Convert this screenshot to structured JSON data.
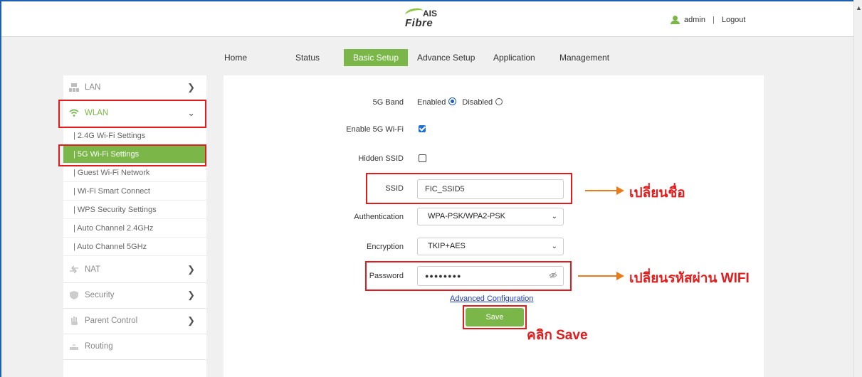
{
  "brand": {
    "top": "AIS",
    "bottom": "Fibre",
    "accent": "#7ab648"
  },
  "user": {
    "name": "admin",
    "separator": "|",
    "logout": "Logout"
  },
  "nav": [
    "Home",
    "Status",
    "Basic Setup",
    "Advance Setup",
    "Application",
    "Management"
  ],
  "nav_active": "Basic Setup",
  "sidebar": {
    "lan": "LAN",
    "wlan": "WLAN",
    "wlan_sub": [
      "| 2.4G Wi-Fi Settings",
      "| 5G Wi-Fi Settings",
      "| Guest Wi-Fi Network",
      "| Wi-Fi Smart Connect",
      "| WPS Security Settings",
      "| Auto Channel 2.4GHz",
      "| Auto Channel 5GHz"
    ],
    "nat": "NAT",
    "security": "Security",
    "parent_control": "Parent Control",
    "routing": "Routing",
    "selected": "| 5G Wi-Fi Settings"
  },
  "form": {
    "band_label": "5G Band",
    "band_enabled": "Enabled",
    "band_disabled": "Disabled",
    "band_value": "Enabled",
    "enable_label": "Enable 5G Wi-Fi",
    "enable_checked": true,
    "hidden_label": "Hidden SSID",
    "hidden_checked": false,
    "ssid_label": "SSID",
    "ssid_value": "FIC_SSID5",
    "auth_label": "Authentication",
    "auth_value": "WPA-PSK/WPA2-PSK",
    "enc_label": "Encryption",
    "enc_value": "TKIP+AES",
    "pw_label": "Password",
    "pw_value": "●●●●●●●●",
    "advanced_link": "Advanced Configuration",
    "save_label": "Save"
  },
  "annotations": {
    "ssid_note": "เปลี่ยนชื่อ",
    "password_note": "เปลี่ยนรหัสผ่าน WIFI",
    "save_note": "คลิก Save",
    "highlight_color": "#e21c1c",
    "arrow_color": "#e87b1c"
  }
}
